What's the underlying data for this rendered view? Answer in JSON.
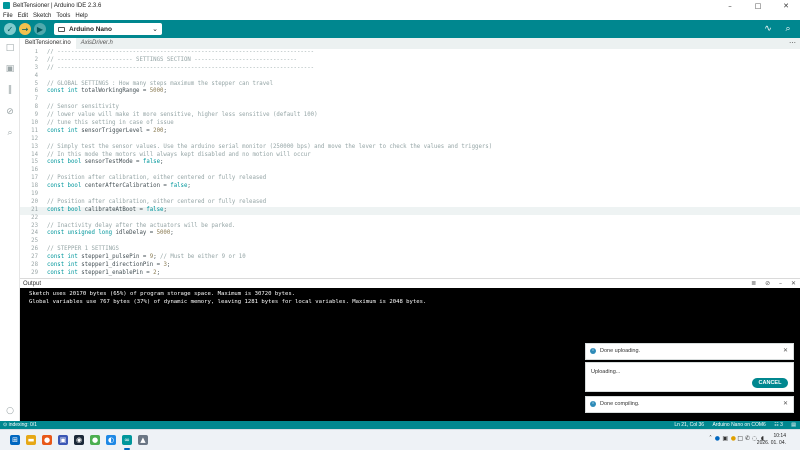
{
  "window": {
    "title": "BeltTensioner | Arduino IDE 2.3.6",
    "minimize": "–",
    "maximize": "□",
    "close": "✕"
  },
  "menu": [
    "File",
    "Edit",
    "Sketch",
    "Tools",
    "Help"
  ],
  "toolbar": {
    "verify_icon": "✓",
    "upload_icon": "→",
    "debug_icon": "▶",
    "board_label": "Arduino Nano",
    "board_chevron": "⌄",
    "serial_plotter_icon": "∿",
    "serial_monitor_icon": "⌕",
    "colors": {
      "toolbar": "#00878f",
      "upload": "#f2c14e"
    }
  },
  "sidebar": {
    "icons": [
      {
        "name": "sketchbook-icon",
        "glyph": "□"
      },
      {
        "name": "boards-manager-icon",
        "glyph": "▣"
      },
      {
        "name": "library-manager-icon",
        "glyph": "‖"
      },
      {
        "name": "debug-icon",
        "glyph": "⊘"
      },
      {
        "name": "search-icon",
        "glyph": "⌕"
      },
      {
        "name": "profile-icon",
        "glyph": "○"
      }
    ]
  },
  "tabs": [
    {
      "label": "BeltTensioner.ino",
      "active": true
    },
    {
      "label": "AxisDriver.h",
      "active": false
    }
  ],
  "tabs_more": "⋯",
  "editor": {
    "highlight_line": 21,
    "lines": [
      {
        "n": "1",
        "parts": [
          {
            "t": "// ---------------------------------------------------------------------------",
            "c": "cmt"
          }
        ]
      },
      {
        "n": "2",
        "parts": [
          {
            "t": "// ---------------------- SETTINGS SECTION ------------------------------",
            "c": "cmt"
          }
        ]
      },
      {
        "n": "3",
        "parts": [
          {
            "t": "// ---------------------------------------------------------------------------",
            "c": "cmt"
          }
        ]
      },
      {
        "n": "4",
        "parts": []
      },
      {
        "n": "5",
        "parts": [
          {
            "t": "// GLOBAL SETTINGS : How many steps maximum the stepper can travel",
            "c": "cmt"
          }
        ]
      },
      {
        "n": "6",
        "parts": [
          {
            "t": "const int",
            "c": "kw"
          },
          {
            "t": " totalWorkingRange = ",
            "c": "txt"
          },
          {
            "t": "5000",
            "c": "num"
          },
          {
            "t": ";",
            "c": "txt"
          }
        ]
      },
      {
        "n": "7",
        "parts": []
      },
      {
        "n": "8",
        "parts": [
          {
            "t": "// Sensor sensitivity",
            "c": "cmt"
          }
        ]
      },
      {
        "n": "9",
        "parts": [
          {
            "t": "// lower value will make it more sensitive, higher less sensitive (default 100)",
            "c": "cmt"
          }
        ]
      },
      {
        "n": "10",
        "parts": [
          {
            "t": "// tune this setting in case of issue",
            "c": "cmt"
          }
        ]
      },
      {
        "n": "11",
        "parts": [
          {
            "t": "const int",
            "c": "kw"
          },
          {
            "t": " sensorTriggerLevel = ",
            "c": "txt"
          },
          {
            "t": "200",
            "c": "num"
          },
          {
            "t": ";",
            "c": "txt"
          }
        ]
      },
      {
        "n": "12",
        "parts": []
      },
      {
        "n": "13",
        "parts": [
          {
            "t": "// Simply test the sensor values. Use the arduino serial monitor (250000 bps) and move the lever to check the values and triggers)",
            "c": "cmt"
          }
        ]
      },
      {
        "n": "14",
        "parts": [
          {
            "t": "// In this mode the motors will always kept disabled and no motion will occur",
            "c": "cmt"
          }
        ]
      },
      {
        "n": "15",
        "parts": [
          {
            "t": "const bool",
            "c": "kw"
          },
          {
            "t": " sensorTestMode = ",
            "c": "txt"
          },
          {
            "t": "false",
            "c": "kw"
          },
          {
            "t": ";",
            "c": "txt"
          }
        ]
      },
      {
        "n": "16",
        "parts": []
      },
      {
        "n": "17",
        "parts": [
          {
            "t": "// Position after calibration, either centered or fully released",
            "c": "cmt"
          }
        ]
      },
      {
        "n": "18",
        "parts": [
          {
            "t": "const bool",
            "c": "kw"
          },
          {
            "t": " centerAfterCalibration = ",
            "c": "txt"
          },
          {
            "t": "false",
            "c": "kw"
          },
          {
            "t": ";",
            "c": "txt"
          }
        ]
      },
      {
        "n": "19",
        "parts": []
      },
      {
        "n": "20",
        "parts": [
          {
            "t": "// Position after calibration, either centered or fully released",
            "c": "cmt"
          }
        ]
      },
      {
        "n": "21",
        "parts": [
          {
            "t": "const bool",
            "c": "kw"
          },
          {
            "t": " calibrateAtBoot = ",
            "c": "txt"
          },
          {
            "t": "false",
            "c": "kw"
          },
          {
            "t": ";",
            "c": "txt"
          }
        ]
      },
      {
        "n": "22",
        "parts": []
      },
      {
        "n": "23",
        "parts": [
          {
            "t": "// Inactivity delay after the actuators will be parked.",
            "c": "cmt"
          }
        ]
      },
      {
        "n": "24",
        "parts": [
          {
            "t": "const unsigned long",
            "c": "kw"
          },
          {
            "t": " idleDelay = ",
            "c": "txt"
          },
          {
            "t": "5000",
            "c": "num"
          },
          {
            "t": ";",
            "c": "txt"
          }
        ]
      },
      {
        "n": "25",
        "parts": []
      },
      {
        "n": "26",
        "parts": [
          {
            "t": "// STEPPER 1 SETTINGS",
            "c": "cmt"
          }
        ]
      },
      {
        "n": "27",
        "parts": [
          {
            "t": "const int",
            "c": "kw"
          },
          {
            "t": " stepper1_pulsePin = ",
            "c": "txt"
          },
          {
            "t": "9",
            "c": "num"
          },
          {
            "t": "; ",
            "c": "txt"
          },
          {
            "t": "// Must be either 9 or 10",
            "c": "cmt"
          }
        ]
      },
      {
        "n": "28",
        "parts": [
          {
            "t": "const int",
            "c": "kw"
          },
          {
            "t": " stepper1_directionPin = ",
            "c": "txt"
          },
          {
            "t": "3",
            "c": "num"
          },
          {
            "t": ";",
            "c": "txt"
          }
        ]
      },
      {
        "n": "29",
        "parts": [
          {
            "t": "const int",
            "c": "kw"
          },
          {
            "t": " stepper1_enablePin = ",
            "c": "txt"
          },
          {
            "t": "2",
            "c": "num"
          },
          {
            "t": ";",
            "c": "txt"
          }
        ]
      }
    ]
  },
  "output": {
    "title": "Output",
    "icons": [
      "≣",
      "⊘",
      "–",
      "✕"
    ],
    "lines": [
      "Sketch uses 20170 bytes (65%) of program storage space. Maximum is 30720 bytes.",
      "Global variables use 767 bytes (37%) of dynamic memory, leaving 1281 bytes for local variables. Maximum is 2048 bytes."
    ]
  },
  "notifications": {
    "done_uploading": "Done uploading.",
    "uploading": "Uploading...",
    "cancel": "CANCEL",
    "done_compiling": "Done compiling.",
    "info_icon": "i",
    "close_icon": "✕"
  },
  "status": {
    "left": "⊙ indexing: 0/1",
    "position": "Ln 21, Col 36",
    "board": "Arduino Nano on COM6",
    "notifications": "☷ 3",
    "panel": "▤"
  },
  "taskbar": {
    "time": "10:14",
    "date": "2026. 01. 04.",
    "apps": [
      {
        "name": "windows-start-icon",
        "glyph": "⊞",
        "color": "#0067c0"
      },
      {
        "name": "file-explorer-icon",
        "glyph": "▬",
        "color": "#e6a817"
      },
      {
        "name": "firefox-icon",
        "glyph": "●",
        "color": "#e8591a"
      },
      {
        "name": "save-app-icon",
        "glyph": "▣",
        "color": "#3b57b5"
      },
      {
        "name": "steam-icon",
        "glyph": "◉",
        "color": "#1b2838"
      },
      {
        "name": "chrome-icon",
        "glyph": "●",
        "color": "#4caf50"
      },
      {
        "name": "browser-icon",
        "glyph": "◐",
        "color": "#1e88e5"
      },
      {
        "name": "arduino-ide-icon",
        "glyph": "∞",
        "color": "#00979c"
      },
      {
        "name": "app-icon",
        "glyph": "▲",
        "color": "#6b7785"
      }
    ],
    "tray": [
      "˄",
      "●",
      "▣",
      "●",
      "□",
      "✆",
      "◌",
      "◖"
    ]
  }
}
